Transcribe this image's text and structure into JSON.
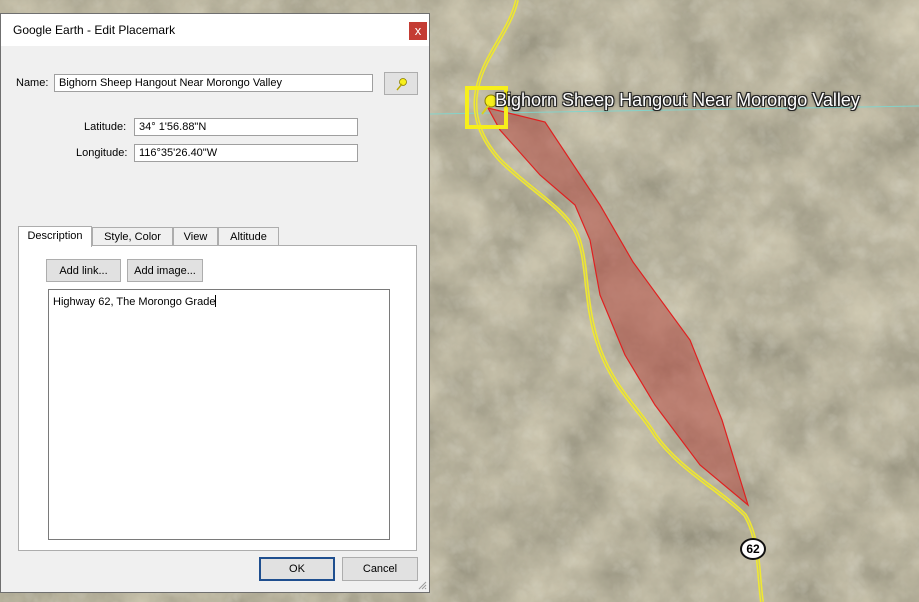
{
  "dialog": {
    "title": "Google Earth - Edit Placemark",
    "close_glyph": "x",
    "name_label": "Name:",
    "name_value": "Bighorn Sheep Hangout Near Morongo Valley",
    "pin_icon": "yellow-pushpin-icon",
    "latitude_label": "Latitude:",
    "latitude_value": "34° 1'56.88\"N",
    "longitude_label": "Longitude:",
    "longitude_value": "116°35'26.40\"W",
    "tabs": [
      {
        "label": "Description",
        "active": true
      },
      {
        "label": "Style, Color",
        "active": false
      },
      {
        "label": "View",
        "active": false
      },
      {
        "label": "Altitude",
        "active": false
      }
    ],
    "add_link_label": "Add link...",
    "add_image_label": "Add image...",
    "description_text": "Highway 62, The Morongo Grade",
    "ok_label": "OK",
    "cancel_label": "Cancel"
  },
  "map": {
    "placemark_label": "Bighorn Sheep Hangout Near Morongo Valley",
    "highway_shield": "62",
    "colors": {
      "road": "#f2ea2a",
      "polygon_fill": "#b54a44",
      "polygon_stroke": "#e02020",
      "selection_box": "#f7ef1b"
    }
  }
}
